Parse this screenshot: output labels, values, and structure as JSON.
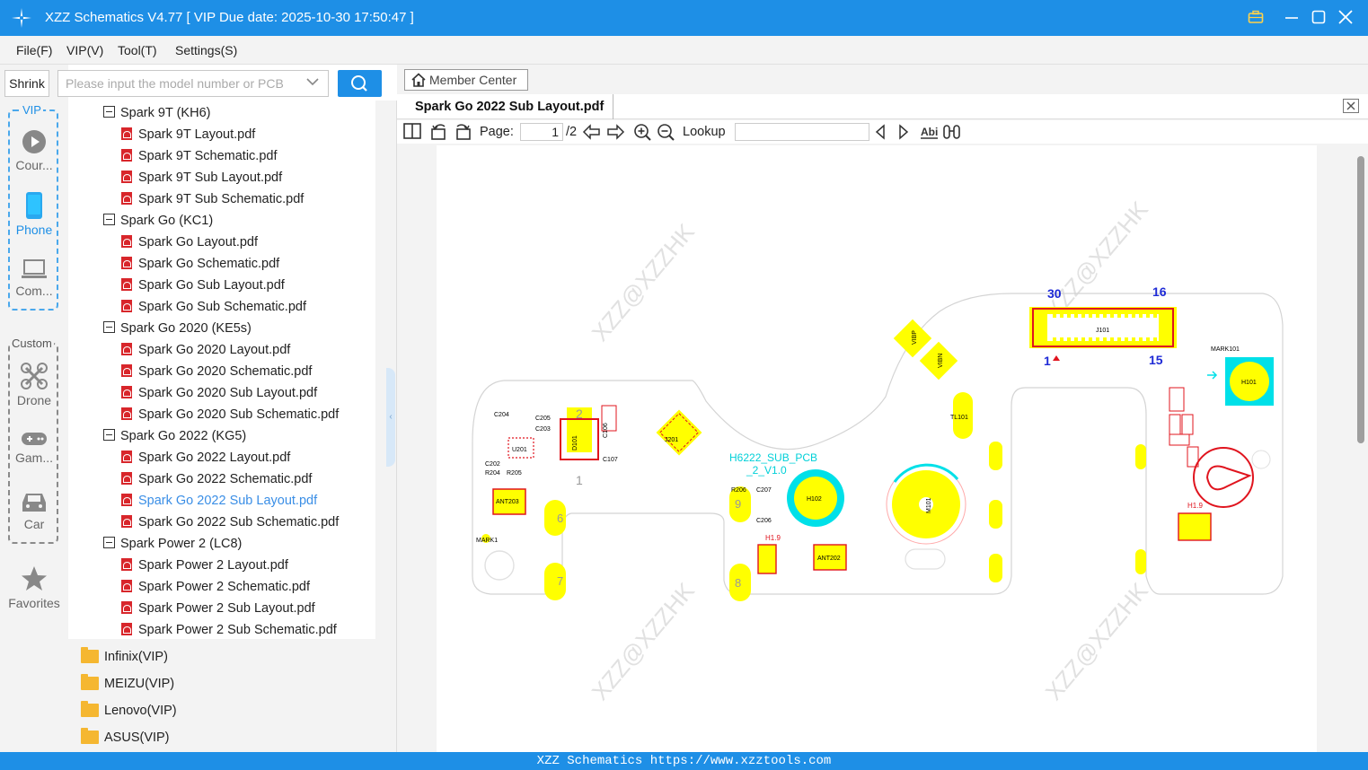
{
  "window": {
    "title": "XZZ Schematics V4.77 [ VIP Due date: 2025-10-30 17:50:47 ]"
  },
  "menu": {
    "items": [
      "File(F)",
      "VIP(V)",
      "Tool(T)",
      "Settings(S)"
    ]
  },
  "toolbar_left": {
    "shrink_label": "Shrink",
    "search_placeholder": "Please input the model number or PCB"
  },
  "nav": {
    "vip_group_label": "VIP",
    "custom_group_label": "Custom",
    "items": [
      {
        "label": "Cour...",
        "icon": "play-icon"
      },
      {
        "label": "Phone",
        "icon": "phone-icon",
        "active": true
      },
      {
        "label": "Com...",
        "icon": "laptop-icon"
      },
      {
        "label": "Drone",
        "icon": "drone-icon"
      },
      {
        "label": "Gam...",
        "icon": "gamepad-icon"
      },
      {
        "label": "Car",
        "icon": "car-icon"
      },
      {
        "label": "Favorites",
        "icon": "star-icon"
      }
    ]
  },
  "tree": {
    "nodes": [
      {
        "type": "group",
        "label": "Spark 9T (KH6)"
      },
      {
        "type": "file",
        "label": "Spark 9T Layout.pdf"
      },
      {
        "type": "file",
        "label": "Spark 9T Schematic.pdf"
      },
      {
        "type": "file",
        "label": "Spark 9T Sub Layout.pdf"
      },
      {
        "type": "file",
        "label": "Spark 9T Sub Schematic.pdf"
      },
      {
        "type": "group",
        "label": "Spark Go (KC1)"
      },
      {
        "type": "file",
        "label": "Spark Go Layout.pdf"
      },
      {
        "type": "file",
        "label": "Spark Go Schematic.pdf"
      },
      {
        "type": "file",
        "label": "Spark Go Sub Layout.pdf"
      },
      {
        "type": "file",
        "label": "Spark Go Sub Schematic.pdf"
      },
      {
        "type": "group",
        "label": "Spark Go 2020 (KE5s)"
      },
      {
        "type": "file",
        "label": "Spark Go 2020 Layout.pdf"
      },
      {
        "type": "file",
        "label": "Spark Go 2020 Schematic.pdf"
      },
      {
        "type": "file",
        "label": "Spark Go 2020 Sub Layout.pdf"
      },
      {
        "type": "file",
        "label": "Spark Go 2020 Sub Schematic.pdf"
      },
      {
        "type": "group",
        "label": "Spark Go 2022 (KG5)"
      },
      {
        "type": "file",
        "label": "Spark Go 2022 Layout.pdf"
      },
      {
        "type": "file",
        "label": "Spark Go 2022 Schematic.pdf"
      },
      {
        "type": "file",
        "label": "Spark Go 2022 Sub Layout.pdf",
        "selected": true
      },
      {
        "type": "file",
        "label": "Spark Go 2022 Sub Schematic.pdf"
      },
      {
        "type": "group",
        "label": "Spark Power 2 (LC8)"
      },
      {
        "type": "file",
        "label": "Spark Power 2 Layout.pdf"
      },
      {
        "type": "file",
        "label": "Spark Power 2 Schematic.pdf"
      },
      {
        "type": "file",
        "label": "Spark Power 2 Sub Layout.pdf"
      },
      {
        "type": "file",
        "label": "Spark Power 2 Sub Schematic.pdf"
      }
    ],
    "folders": [
      "Infinix(VIP)",
      "MEIZU(VIP)",
      "Lenovo(VIP)",
      "ASUS(VIP)"
    ]
  },
  "viewer": {
    "member_center": "Member Center",
    "tab_title": "Spark Go 2022 Sub Layout.pdf",
    "page_label": "Page:",
    "page_current": "1",
    "page_total": "/2",
    "lookup_label": "Lookup",
    "lookup_value": ""
  },
  "layout": {
    "board_name": "H6222_SUB_PCB _2_V1.0",
    "watermark": "XZZ@XZZHK",
    "connector": {
      "ref": "J101",
      "pin_top_left": "30",
      "pin_top_right": "16",
      "pin_bottom_left": "1",
      "pin_bottom_right": "15"
    },
    "components": [
      "C204",
      "C205",
      "C203",
      "R201",
      "U201",
      "R203",
      "R202",
      "C202",
      "R204",
      "R205",
      "D101",
      "R107",
      "C106",
      "C107",
      "T106",
      "J201",
      "ANT203",
      "H1.9",
      "MARK1",
      "R106",
      "R206",
      "C207",
      "R207",
      "C206",
      "H102",
      "ANT201",
      "ANT202",
      "M101",
      "VIBP",
      "VIBN",
      "TL101",
      "MARK101",
      "H101",
      "B104",
      "T105",
      "C127",
      "T111",
      "R105",
      "PL101",
      "ANT206"
    ],
    "hole_numbers": [
      "2",
      "6",
      "7",
      "9",
      "8",
      "5",
      "3",
      "2",
      "4",
      "1"
    ]
  },
  "status": {
    "text": "XZZ Schematics https://www.xzztools.com"
  },
  "colors": {
    "accent": "#1e8fe6",
    "pad_yellow": "#ffff00",
    "silk_red": "#e0141e",
    "cyan": "#00e0e8",
    "pin_blue": "#1e2ad6"
  }
}
